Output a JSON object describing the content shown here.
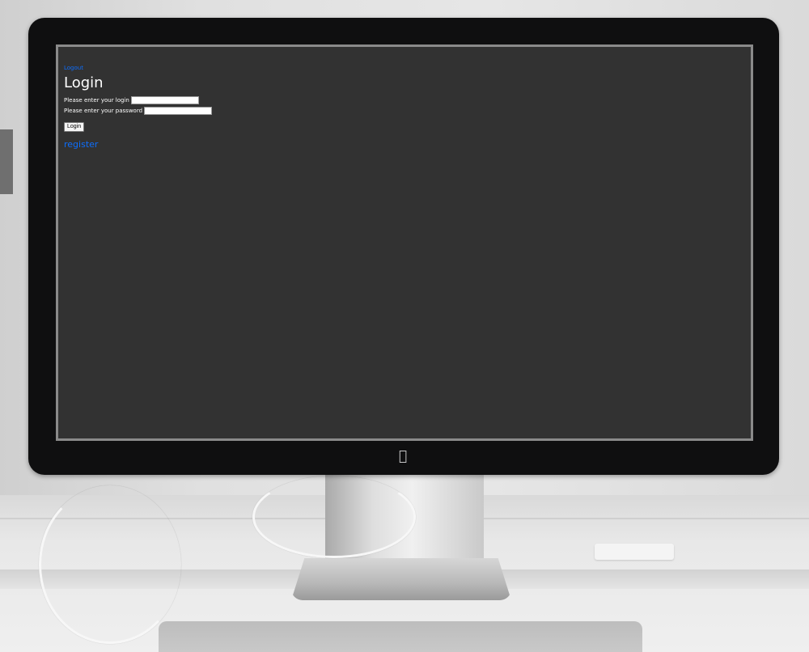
{
  "app": {
    "logout_label": "Logout",
    "title": "Login",
    "login_prompt": "Please enter your login",
    "password_prompt": "Please enter your password",
    "login_value": "",
    "password_value": "",
    "login_button_label": "Login",
    "register_label": "register"
  },
  "icons": {
    "brand_logo": "apple-logo"
  },
  "colors": {
    "screen_background": "#323232",
    "link": "#0d6efd",
    "text": "#ffffff"
  }
}
